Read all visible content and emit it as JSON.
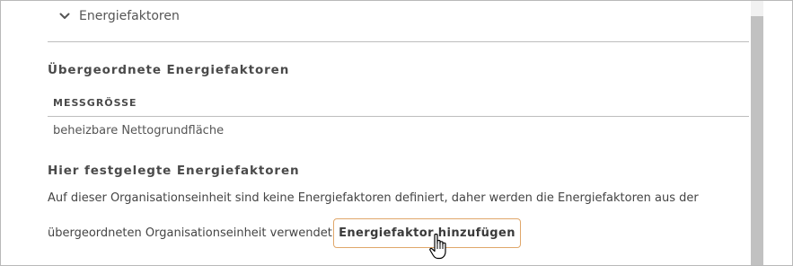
{
  "collapse": {
    "label": "Energiefaktoren",
    "icon": "chevron-down-icon"
  },
  "parent_section": {
    "title": "Übergeordnete Energiefaktoren",
    "table": {
      "columns": [
        "MESSGRÖSSE"
      ],
      "rows": [
        [
          "beheizbare Nettogrundfläche"
        ]
      ]
    }
  },
  "local_section": {
    "title": "Hier festgelegte Energiefaktoren",
    "info_line1": "Auf dieser Organisationseinheit sind keine Energiefaktoren definiert, daher werden die Energiefaktoren aus der",
    "info_line2": "übergeordneten Organisationseinheit verwendet.",
    "add_button_label": "Energiefaktor hinzufügen"
  },
  "colors": {
    "button_border": "#e0a76a",
    "divider": "#bdbdbd",
    "scroll_thumb": "#c1c1c1",
    "text": "#4a4a4a"
  }
}
